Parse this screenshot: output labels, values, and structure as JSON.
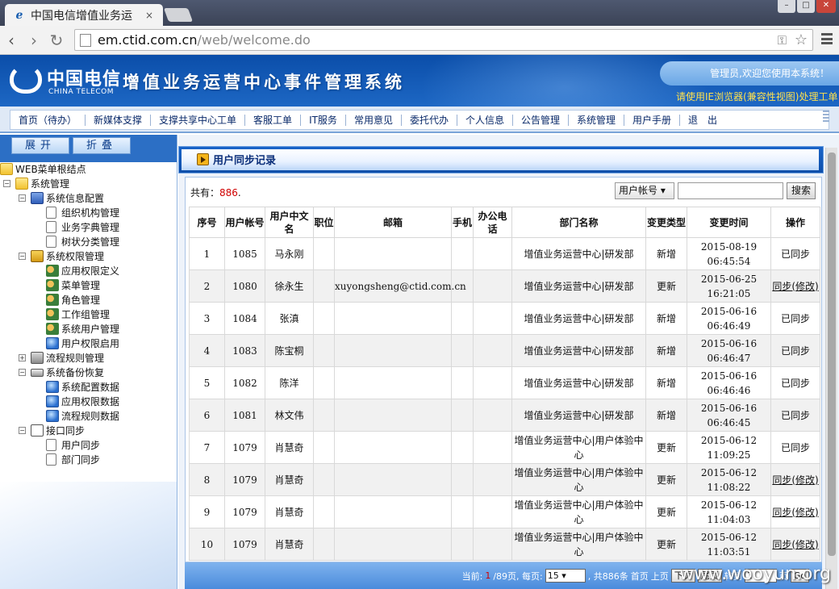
{
  "browser": {
    "tab_title": "中国电信增值业务运",
    "tab_close": "×",
    "url_host": "em.ctid.com.cn",
    "url_path": "/web/welcome.do"
  },
  "header": {
    "logo_cn": "中国电信",
    "logo_en": "CHINA TELECOM",
    "system_title": "增值业务运营中心事件管理系统",
    "welcome": "管理员,欢迎您使用本系统！",
    "ie_tip": "请使用IE浏览器(兼容性视图)处理工单"
  },
  "topnav": [
    "首页（待办）",
    "新媒体支撑",
    "支撑共享中心工单",
    "客服工单",
    "IT服务",
    "常用意见",
    "委托代办",
    "个人信息",
    "公告管理",
    "系统管理",
    "用户手册",
    "退　出"
  ],
  "sidebar": {
    "expand_label": "展开",
    "collapse_label": "折叠",
    "tree": [
      {
        "label": "WEB菜单根结点",
        "level": 0,
        "toggle": "",
        "icon": "folder-icon"
      },
      {
        "label": "系统管理",
        "level": 1,
        "toggle": "−",
        "icon": "folder-icon"
      },
      {
        "label": "系统信息配置",
        "level": 2,
        "toggle": "−",
        "icon": "book-icon"
      },
      {
        "label": "组织机构管理",
        "level": 3,
        "toggle": "",
        "icon": "page-icon"
      },
      {
        "label": "业务字典管理",
        "level": 3,
        "toggle": "",
        "icon": "page-icon"
      },
      {
        "label": "树状分类管理",
        "level": 3,
        "toggle": "",
        "icon": "page-icon"
      },
      {
        "label": "系统权限管理",
        "level": 2,
        "toggle": "−",
        "icon": "lock-icon"
      },
      {
        "label": "应用权限定义",
        "level": 3,
        "toggle": "",
        "icon": "users-icon"
      },
      {
        "label": "菜单管理",
        "level": 3,
        "toggle": "",
        "icon": "users-icon"
      },
      {
        "label": "角色管理",
        "level": 3,
        "toggle": "",
        "icon": "users-icon"
      },
      {
        "label": "工作组管理",
        "level": 3,
        "toggle": "",
        "icon": "users-icon"
      },
      {
        "label": "系统用户管理",
        "level": 3,
        "toggle": "",
        "icon": "users-icon"
      },
      {
        "label": "用户权限启用",
        "level": 3,
        "toggle": "",
        "icon": "globe-icon"
      },
      {
        "label": "流程规则管理",
        "level": 2,
        "toggle": "+",
        "icon": "server-icon"
      },
      {
        "label": "系统备份恢复",
        "level": 2,
        "toggle": "−",
        "icon": "disk-icon"
      },
      {
        "label": "系统配置数据",
        "level": 3,
        "toggle": "",
        "icon": "globe-icon"
      },
      {
        "label": "应用权限数据",
        "level": 3,
        "toggle": "",
        "icon": "globe-icon"
      },
      {
        "label": "流程规则数据",
        "level": 3,
        "toggle": "",
        "icon": "globe-icon"
      },
      {
        "label": "接口同步",
        "level": 2,
        "toggle": "−",
        "icon": "sync-icon"
      },
      {
        "label": "用户同步",
        "level": 3,
        "toggle": "",
        "icon": "page-icon"
      },
      {
        "label": "部门同步",
        "level": 3,
        "toggle": "",
        "icon": "page-icon"
      }
    ]
  },
  "panel": {
    "title": "用户同步记录",
    "count_prefix": "共有：",
    "count": "886",
    "count_suffix": ".",
    "search_field": "用户帐号 ▾",
    "search_button": "搜索"
  },
  "table": {
    "headers": [
      "序号",
      "用户帐号",
      "用户中文名",
      "职位",
      "邮箱",
      "手机",
      "办公电话",
      "部门名称",
      "变更类型",
      "变更时间",
      "操作"
    ],
    "rows": [
      [
        "1",
        "1085",
        "马永刚",
        "",
        "",
        "",
        "",
        "增值业务运营中心|研发部",
        "新增",
        "2015-08-19 06:45:54",
        "已同步"
      ],
      [
        "2",
        "1080",
        "徐永生",
        "",
        "xuyongsheng@ctid.com.cn",
        "",
        "",
        "增值业务运营中心|研发部",
        "更新",
        "2015-06-25 16:21:05",
        "同步(修改)"
      ],
      [
        "3",
        "1084",
        "张滇",
        "",
        "",
        "",
        "",
        "增值业务运营中心|研发部",
        "新增",
        "2015-06-16 06:46:49",
        "已同步"
      ],
      [
        "4",
        "1083",
        "陈宝桐",
        "",
        "",
        "",
        "",
        "增值业务运营中心|研发部",
        "新增",
        "2015-06-16 06:46:47",
        "已同步"
      ],
      [
        "5",
        "1082",
        "陈洋",
        "",
        "",
        "",
        "",
        "增值业务运营中心|研发部",
        "新增",
        "2015-06-16 06:46:46",
        "已同步"
      ],
      [
        "6",
        "1081",
        "林文伟",
        "",
        "",
        "",
        "",
        "增值业务运营中心|研发部",
        "新增",
        "2015-06-16 06:46:45",
        "已同步"
      ],
      [
        "7",
        "1079",
        "肖慧奇",
        "",
        "",
        "",
        "",
        "增值业务运营中心|用户体验中心",
        "更新",
        "2015-06-12 11:09:25",
        "已同步"
      ],
      [
        "8",
        "1079",
        "肖慧奇",
        "",
        "",
        "",
        "",
        "增值业务运营中心|用户体验中心",
        "更新",
        "2015-06-12 11:08:22",
        "同步(修改)"
      ],
      [
        "9",
        "1079",
        "肖慧奇",
        "",
        "",
        "",
        "",
        "增值业务运营中心|用户体验中心",
        "更新",
        "2015-06-12 11:04:03",
        "同步(修改)"
      ],
      [
        "10",
        "1079",
        "肖慧奇",
        "",
        "",
        "",
        "",
        "增值业务运营中心|用户体验中心",
        "更新",
        "2015-06-12 11:03:51",
        "同步(修改)"
      ]
    ]
  },
  "pager": {
    "prefix": "当前:",
    "current": "1",
    "total_pages": "/89页, 每页:",
    "per_page": "15",
    "total_items": ", 共886条",
    "first": "首页",
    "prev": "上页",
    "next": "下页",
    "last": "尾页",
    "goto_label": "转到",
    "goto_value": "1",
    "page_unit": "页",
    "go": "Go"
  },
  "watermark": "www.wooyun.org"
}
